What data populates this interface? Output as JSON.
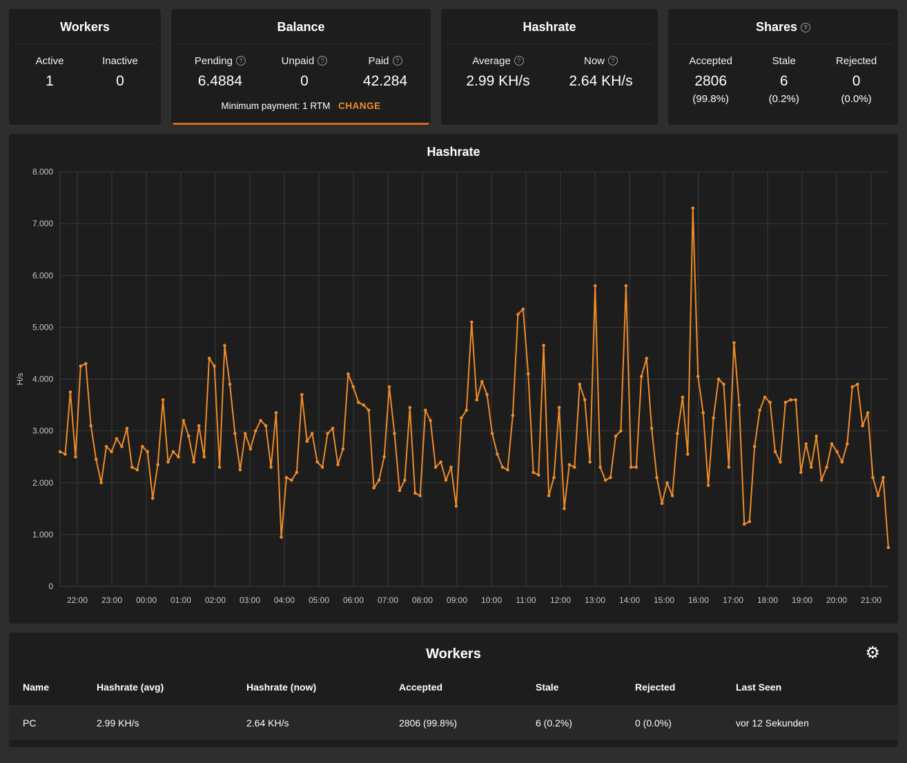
{
  "colors": {
    "accent": "#ef8b2a",
    "chart_line": "#ef8b2a",
    "panel_bg": "#1d1d1d",
    "page_bg": "#2e2e2e",
    "grid": "#3a3a3a"
  },
  "icons": {
    "help": "?",
    "gear": "⚙"
  },
  "cards": {
    "workers": {
      "title": "Workers",
      "stats": [
        {
          "label": "Active",
          "value": "1"
        },
        {
          "label": "Inactive",
          "value": "0"
        }
      ]
    },
    "balance": {
      "title": "Balance",
      "stats": [
        {
          "label": "Pending",
          "value": "6.4884"
        },
        {
          "label": "Unpaid",
          "value": "0"
        },
        {
          "label": "Paid",
          "value": "42.284"
        }
      ],
      "minimum_payment": "Minimum payment: 1 RTM",
      "change_label": "CHANGE"
    },
    "hashrate": {
      "title": "Hashrate",
      "stats": [
        {
          "label": "Average",
          "value": "2.99 KH/s"
        },
        {
          "label": "Now",
          "value": "2.64 KH/s"
        }
      ]
    },
    "shares": {
      "title": "Shares",
      "stats": [
        {
          "label": "Accepted",
          "value": "2806",
          "pct": "(99.8%)"
        },
        {
          "label": "Stale",
          "value": "6",
          "pct": "(0.2%)"
        },
        {
          "label": "Rejected",
          "value": "0",
          "pct": "(0.0%)"
        }
      ]
    }
  },
  "chart_data": {
    "type": "line",
    "title": "Hashrate",
    "xlabel": "",
    "ylabel": "H/s",
    "ylim": [
      0,
      8000
    ],
    "grid": true,
    "legend": false,
    "y_ticks": [
      "0",
      "1.000",
      "2.000",
      "3.000",
      "4.000",
      "5.000",
      "6.000",
      "7.000",
      "8.000"
    ],
    "x_ticks": [
      "22:00",
      "23:00",
      "00:00",
      "01:00",
      "02:00",
      "03:00",
      "04:00",
      "05:00",
      "06:00",
      "07:00",
      "08:00",
      "09:00",
      "10:00",
      "11:00",
      "12:00",
      "13:00",
      "14:00",
      "15:00",
      "16:00",
      "17:00",
      "18:00",
      "19:00",
      "20:00",
      "21:00"
    ],
    "series": [
      {
        "name": "Hashrate (H/s)",
        "color": "#ef8b2a",
        "values": [
          2600,
          2550,
          3750,
          2500,
          4250,
          4300,
          3100,
          2450,
          2000,
          2700,
          2600,
          2850,
          2700,
          3050,
          2300,
          2250,
          2700,
          2600,
          1700,
          2350,
          3600,
          2400,
          2600,
          2500,
          3200,
          2900,
          2400,
          3100,
          2500,
          4400,
          4250,
          2300,
          4650,
          3900,
          2950,
          2250,
          2950,
          2650,
          3000,
          3200,
          3100,
          2300,
          3350,
          950,
          2100,
          2050,
          2200,
          3700,
          2800,
          2950,
          2400,
          2300,
          2950,
          3050,
          2350,
          2650,
          4100,
          3850,
          3550,
          3500,
          3400,
          1900,
          2050,
          2500,
          3850,
          2950,
          1850,
          2050,
          3450,
          1800,
          1750,
          3400,
          3200,
          2300,
          2400,
          2050,
          2300,
          1550,
          3250,
          3400,
          5100,
          3600,
          3950,
          3700,
          2950,
          2550,
          2300,
          2250,
          3300,
          5250,
          5350,
          4100,
          2200,
          2150,
          4650,
          1750,
          2100,
          3450,
          1500,
          2350,
          2300,
          3900,
          3600,
          2400,
          5800,
          2300,
          2050,
          2100,
          2900,
          3000,
          5800,
          2300,
          2300,
          4050,
          4400,
          3050,
          2100,
          1600,
          2000,
          1750,
          2950,
          3650,
          2550,
          7300,
          4050,
          3350,
          1950,
          3250,
          4000,
          3900,
          2300,
          4700,
          3500,
          1200,
          1250,
          2700,
          3400,
          3650,
          3550,
          2600,
          2400,
          3550,
          3600,
          3600,
          2200,
          2750,
          2300,
          2900,
          2050,
          2300,
          2750,
          2600,
          2400,
          2750,
          3850,
          3900,
          3100,
          3350,
          2100,
          1750,
          2100,
          750
        ]
      }
    ]
  },
  "workers_table": {
    "title": "Workers",
    "columns": [
      "Name",
      "Hashrate (avg)",
      "Hashrate (now)",
      "Accepted",
      "Stale",
      "Rejected",
      "Last Seen"
    ],
    "rows": [
      [
        "PC",
        "2.99 KH/s",
        "2.64 KH/s",
        "2806 (99.8%)",
        "6 (0.2%)",
        "0 (0.0%)",
        "vor 12 Sekunden"
      ]
    ]
  }
}
